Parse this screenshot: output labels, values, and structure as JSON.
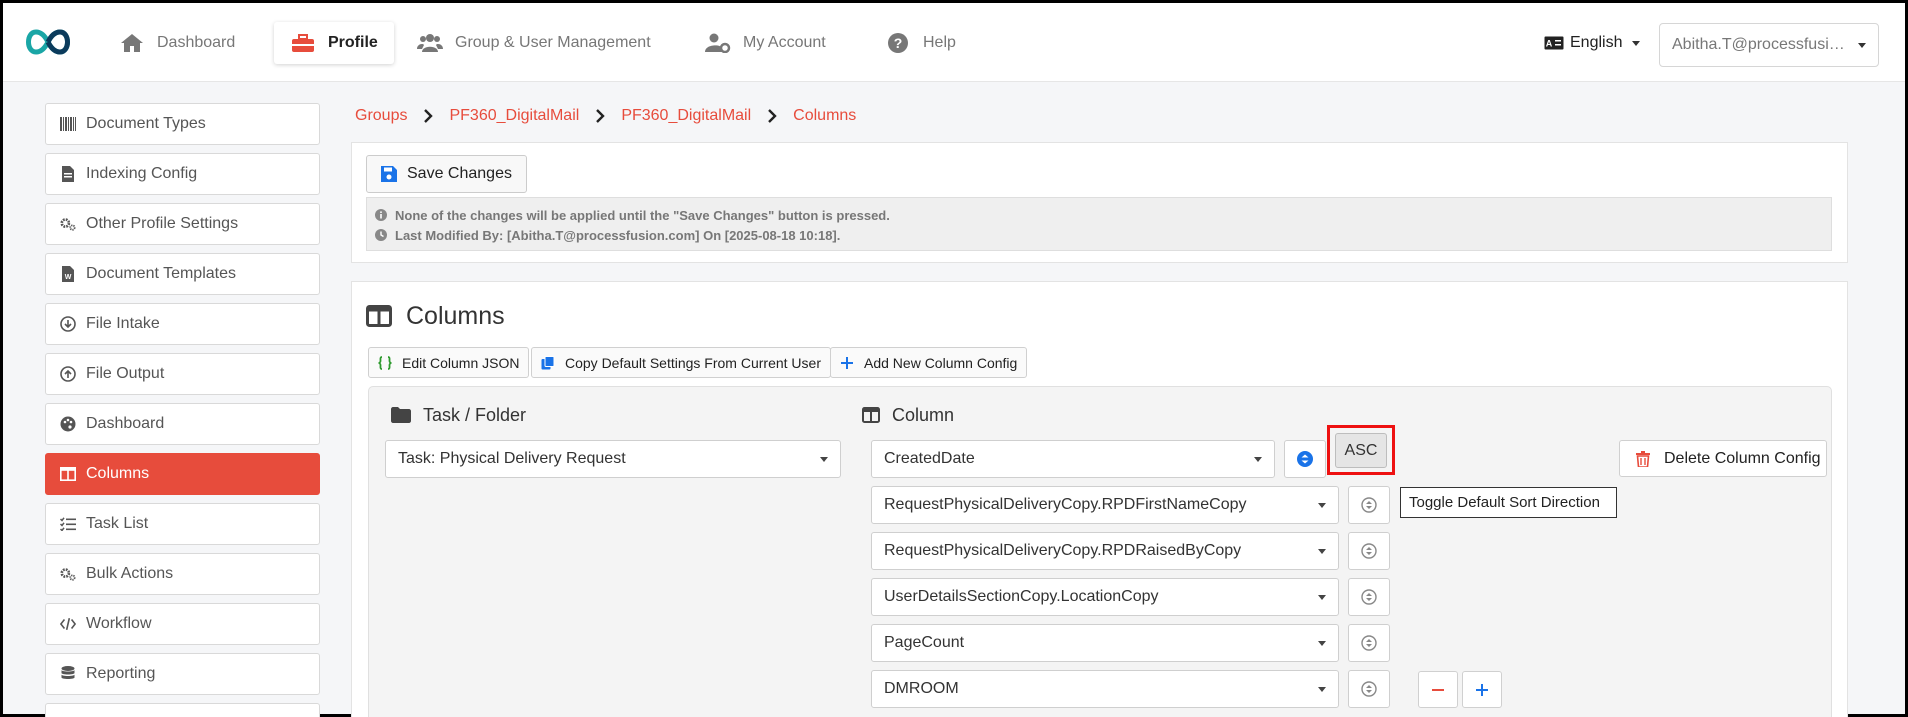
{
  "nav": {
    "items": [
      {
        "label": "Dashboard",
        "icon": "home-icon"
      },
      {
        "label": "Profile",
        "icon": "toolbox-icon",
        "active": true
      },
      {
        "label": "Group & User Management",
        "icon": "users-icon"
      },
      {
        "label": "My Account",
        "icon": "user-cog-icon"
      },
      {
        "label": "Help",
        "icon": "question-circle-icon"
      }
    ],
    "language": "English",
    "user": "Abitha.T@processfusion.com"
  },
  "sidebar": {
    "items": [
      {
        "label": "Document Types",
        "icon": "barcode-icon"
      },
      {
        "label": "Indexing Config",
        "icon": "file-icon"
      },
      {
        "label": "Other Profile Settings",
        "icon": "cogs-icon"
      },
      {
        "label": "Document Templates",
        "icon": "word-file-icon"
      },
      {
        "label": "File Intake",
        "icon": "arrow-circle-down-icon"
      },
      {
        "label": "File Output",
        "icon": "arrow-circle-up-icon"
      },
      {
        "label": "Dashboard",
        "icon": "palette-icon"
      },
      {
        "label": "Columns",
        "icon": "columns-icon",
        "active": true
      },
      {
        "label": "Task List",
        "icon": "tasks-icon"
      },
      {
        "label": "Bulk Actions",
        "icon": "cogs-icon"
      },
      {
        "label": "Workflow",
        "icon": "code-icon"
      },
      {
        "label": "Reporting",
        "icon": "database-icon"
      }
    ]
  },
  "breadcrumb": [
    "Groups",
    "PF360_DigitalMail",
    "PF360_DigitalMail",
    "Columns"
  ],
  "save": {
    "button_label": "Save Changes",
    "note1": "None of the changes will be applied until the \"Save Changes\" button is pressed.",
    "note2": "Last Modified By: [Abitha.T@processfusion.com] On [2025-08-18 10:18]."
  },
  "columns": {
    "title": "Columns",
    "toolbar": {
      "edit_json": "Edit Column JSON",
      "copy_default": "Copy Default Settings From Current User",
      "add_new": "Add New Column Config"
    },
    "task_folder_title": "Task / Folder",
    "task_value": "Task: Physical Delivery Request",
    "column_title": "Column",
    "rows": [
      "CreatedDate",
      "RequestPhysicalDeliveryCopy.RPDFirstNameCopy",
      "RequestPhysicalDeliveryCopy.RPDRaisedByCopy",
      "UserDetailsSectionCopy.LocationCopy",
      "PageCount",
      "DMROOM"
    ],
    "asc_label": "ASC",
    "tooltip": "Toggle Default Sort Direction",
    "delete_label": "Delete Column Config"
  },
  "colors": {
    "accent": "#e74c3c",
    "primary_blue": "#1a73e8",
    "highlight_red": "#ee1111"
  }
}
